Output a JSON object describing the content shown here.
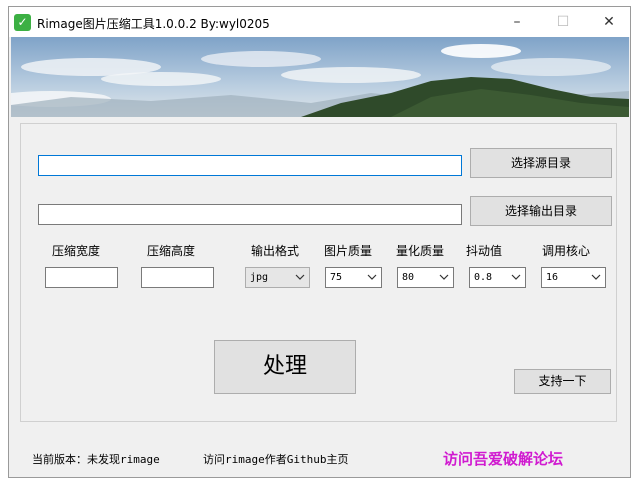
{
  "window": {
    "title": "Rimage图片压缩工具1.0.0.2 By:wyl0205",
    "minimize": "–",
    "maximize": "☐",
    "close": "✕",
    "app_icon": "checkmark-icon"
  },
  "paths": {
    "source_value": "",
    "output_value": "",
    "select_source_label": "选择源目录",
    "select_output_label": "选择输出目录"
  },
  "options": {
    "width_label": "压缩宽度",
    "height_label": "压缩高度",
    "format_label": "输出格式",
    "quality_label": "图片质量",
    "quantize_label": "量化质量",
    "dither_label": "抖动值",
    "cores_label": "调用核心",
    "width_value": "",
    "height_value": "",
    "format_value": "jpg",
    "quality_value": "75",
    "quantize_value": "80",
    "dither_value": "0.8",
    "cores_value": "16"
  },
  "actions": {
    "process_label": "处理",
    "support_label": "支持一下"
  },
  "footer": {
    "version_text": "当前版本：未发现rimage",
    "github_text": "访问rimage作者Github主页",
    "forum_link": "访问吾爱破解论坛"
  },
  "colors": {
    "forum_link": "#d01ad0",
    "focus": "#0078d7"
  }
}
